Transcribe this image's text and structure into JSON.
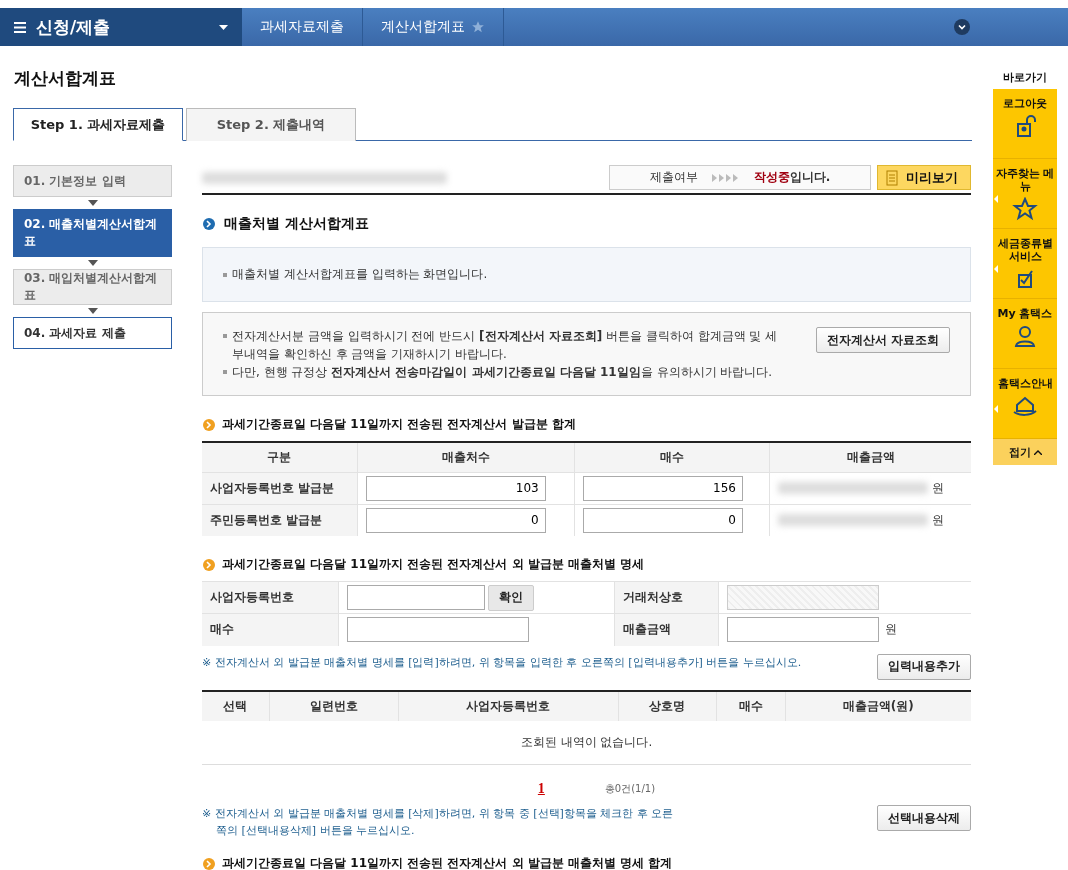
{
  "nav": {
    "title": "신청/제출",
    "breadcrumbs": [
      "과세자료제출",
      "계산서합계표"
    ]
  },
  "page_title": "계산서합계표",
  "tabs": [
    {
      "label": "Step 1. 과세자료제출",
      "selected": true
    },
    {
      "label": "Step 2. 제출내역",
      "selected": false
    }
  ],
  "steps": [
    {
      "label": "01. 기본정보 입력",
      "kind": "done"
    },
    {
      "label": "02. 매출처별계산서합계표",
      "kind": "current"
    },
    {
      "label": "03. 매입처별계산서합계표",
      "kind": "done"
    },
    {
      "label": "04. 과세자료 제출",
      "kind": "next"
    }
  ],
  "status": {
    "label": "제출여부",
    "value": "작성중",
    "suffix": "입니다."
  },
  "preview_button": "미리보기",
  "section_title": "매출처별 계산서합계표",
  "intro": "매출처별 계산서합계표를 입력하는 화면입니다.",
  "notice": {
    "items": [
      "전자계산서분 금액을 입력하시기 전에 반드시 **[전자계산서 자료조회]** 버튼을 클릭하여 합계금액 및 세부내역을 확인하신 후 금액을 기재하시기 바랍니다.",
      "다만, 현행 규정상 **전자계산서 전송마감일이 과세기간종료일 다음달 11일임**을 유의하시기 바랍니다."
    ],
    "button": "전자계산서 자료조회"
  },
  "summary": {
    "title": "과세기간종료일 다음달 11일까지 전송된 전자계산서 발급분 합계",
    "columns": [
      "구분",
      "매출처수",
      "매수",
      "매출금액"
    ],
    "rows": [
      {
        "label": "사업자등록번호 발급분",
        "customers": "103",
        "sheets": "156",
        "unit": "원"
      },
      {
        "label": "주민등록번호 발급분",
        "customers": "0",
        "sheets": "0",
        "unit": "원"
      }
    ]
  },
  "detail": {
    "title": "과세기간종료일 다음달 11일까지 전송된 전자계산서 외 발급분 매출처별 명세",
    "biz_no_label": "사업자등록번호",
    "confirm_button": "확인",
    "partner_label": "거래처상호",
    "sheets_label": "매수",
    "amount_label": "매출금액",
    "amount_unit": "원",
    "add_note": "※ 전자계산서 외 발급분 매출처별 명세를 [입력]하려면, 위 항목을 입력한 후 오른쪽의 [입력내용추가] 버튼을 누르십시오.",
    "add_button": "입력내용추가"
  },
  "list": {
    "columns": [
      "선택",
      "일련번호",
      "사업자등록번호",
      "상호명",
      "매수",
      "매출금액(원)"
    ],
    "empty": "조회된 내역이 없습니다.",
    "page": "1",
    "total": "총0건(1/1)",
    "delete_note": "※ 전자계산서 외 발급분 매출처별 명세를 [삭제]하려면, 위 항목 중 [선택]항목을 체크한 후 오른쪽의 [선택내용삭제] 버튼을 누르십시오.",
    "delete_button": "선택내용삭제"
  },
  "next_title": "과세기간종료일 다음달 11일까지 전송된 전자계산서 외 발급분 매출처별 명세 합계",
  "quick": {
    "title": "바로가기",
    "items": [
      {
        "label": "로그아웃",
        "kind": "lock",
        "submenu": false
      },
      {
        "label": "자주찾는 메뉴",
        "kind": "star",
        "submenu": true
      },
      {
        "label": "세금종류별 서비스",
        "kind": "check",
        "submenu": true
      },
      {
        "label": "My 홈택스",
        "kind": "person",
        "submenu": false
      },
      {
        "label": "홈택스안내",
        "kind": "house",
        "submenu": true
      }
    ],
    "collapse": "접기"
  }
}
